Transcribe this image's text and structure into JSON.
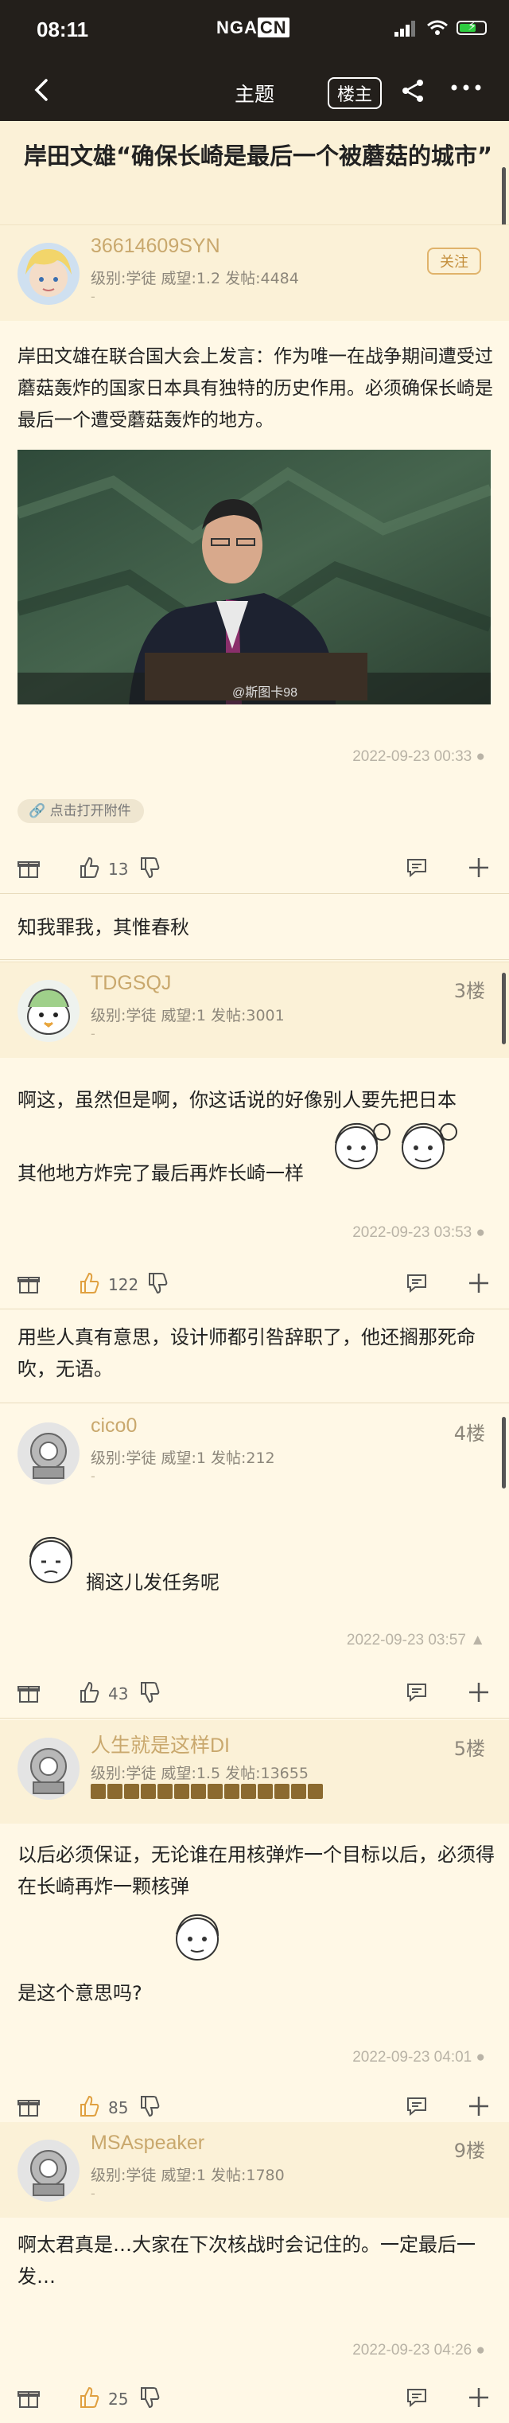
{
  "status": {
    "time": "08:11",
    "brand_left": "NGA",
    "brand_cn": "CN"
  },
  "nav": {
    "title": "主题",
    "louzhu_label": "楼主"
  },
  "thread": {
    "title": "岸田文雄“确保长崎是最后一个被蘑菇的城市”"
  },
  "op": {
    "username": "36614609SYN",
    "meta": "级别:学徒  威望:1.2  发帖:4484",
    "dash": "-",
    "follow_label": "关注",
    "text": "岸田文雄在联合国大会上发言：作为唯一在战争期间遭受过蘑菇轰炸的国家日本具有独特的历史作用。必须确保长崎是最后一个遭受蘑菇轰炸的地方。",
    "watermark": "@斯图卡98",
    "timestamp": "2022-09-23 00:33",
    "attachment_label": "点击打开附件",
    "likes": "13"
  },
  "quote1": {
    "text": "知我罪我，其惟春秋"
  },
  "post3": {
    "username": "TDGSQJ",
    "floor": "3楼",
    "meta": "级别:学徒  威望:1  发帖:3001",
    "dash": "-",
    "text_line1": "啊这，虽然但是啊，你这话说的好像别人要先把日本",
    "text_line2": "其他地方炸完了最后再炸长崎一样",
    "timestamp": "2022-09-23 03:53",
    "likes": "122"
  },
  "quote2": {
    "text": "用些人真有意思，设计师都引咎辞职了，他还搁那死命吹，无语。"
  },
  "post4": {
    "username": "cico0",
    "floor": "4楼",
    "meta": "级别:学徒  威望:1  发帖:212",
    "dash": "-",
    "text": "搁这儿发任务呢",
    "timestamp": "2022-09-23 03:57",
    "likes": "43"
  },
  "post5": {
    "username": "人生就是这样DI",
    "floor": "5楼",
    "meta": "级别:学徒  威望:1.5  发帖:13655",
    "text": "以后必须保证，无论谁在用核弹炸一个目标以后，必须得在长崎再炸一颗核弹",
    "text2": "是这个意思吗?",
    "timestamp": "2022-09-23 04:01",
    "likes": "85"
  },
  "post9": {
    "username": "MSAspeaker",
    "floor": "9楼",
    "meta": "级别:学徒  威望:1  发帖:1780",
    "dash": "-",
    "text": "啊太君真是…大家在下次核战时会记住的。一定最后一发…",
    "timestamp": "2022-09-23 04:26",
    "likes": "25"
  },
  "colors": {
    "topbar": "#231f1b",
    "background": "#fff8e6",
    "username": "#c9a86d",
    "accent": "#e0b36b"
  }
}
